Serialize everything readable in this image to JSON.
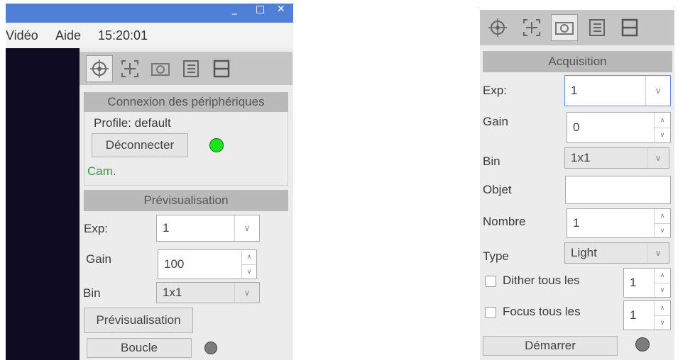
{
  "left_window": {
    "menu": {
      "video": "Vidéo",
      "help": "Aide",
      "clock": "15:20:01"
    },
    "title_controls": {
      "minimize": "_",
      "maximize": "□",
      "close": "✕"
    },
    "toolbar_icons": [
      "crosshair-icon",
      "focus-icon",
      "camera-icon",
      "list-icon",
      "save-icon"
    ],
    "connection": {
      "header": "Connexion des périphériques",
      "profile": "Profile: default",
      "disconnect": "Déconnecter",
      "status_color": "#19e619",
      "cam_label": "Cam.",
      "cam_color": "#3a9a3a"
    },
    "preview": {
      "header": "Prévisualisation",
      "exp_label": "Exp:",
      "exp_value": "1",
      "gain_label": "Gain",
      "gain_value": "100",
      "bin_label": "Bin",
      "bin_value": "1x1",
      "preview_button": "Prévisualisation",
      "loop_button": "Boucle",
      "loop_led_color": "#7c7c7c"
    }
  },
  "right_window": {
    "toolbar_icons": [
      "crosshair-icon",
      "focus-icon",
      "camera-icon",
      "list-icon",
      "save-icon"
    ],
    "acquisition": {
      "header": "Acquisition",
      "exp_label": "Exp:",
      "exp_value": "1",
      "gain_label": "Gain",
      "gain_value": "0",
      "bin_label": "Bin",
      "bin_value": "1x1",
      "object_label": "Objet",
      "object_value": "",
      "count_label": "Nombre",
      "count_value": "1",
      "type_label": "Type",
      "type_value": "Light",
      "dither_label": "Dither tous les",
      "dither_value": "1",
      "focus_label": "Focus tous les",
      "focus_value": "1",
      "start_button": "Démarrer",
      "start_led_color": "#7c7c7c"
    }
  },
  "colors": {
    "titlebar": "#4f7fd6",
    "section_header": "#b9b9b9",
    "toolbar": "#c5c5c5"
  }
}
